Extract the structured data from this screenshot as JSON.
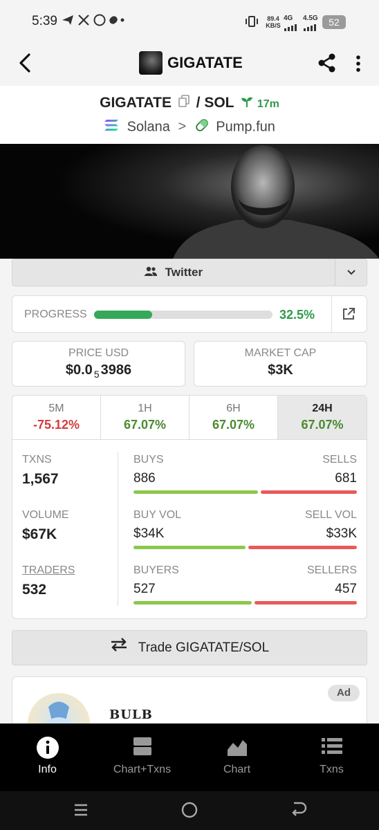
{
  "status_bar": {
    "time": "5:39",
    "net_speed": "89.4 KB/S",
    "signal1": "4G",
    "signal2": "4.5G",
    "battery": "52"
  },
  "app_bar": {
    "title": "GIGATATE"
  },
  "header": {
    "pair_base": "GIGATATE",
    "pair_sep": "/",
    "pair_quote": "SOL",
    "age": "17m",
    "chain": "Solana",
    "chevron": ">",
    "dex": "Pump.fun"
  },
  "twitter_button": {
    "label": "Twitter"
  },
  "progress": {
    "label": "PROGRESS",
    "value": "32.5%",
    "fraction": 0.325
  },
  "price": {
    "label": "PRICE USD",
    "prefix": "$0.0",
    "subscript": "5",
    "suffix": "3986"
  },
  "market_cap": {
    "label": "MARKET CAP",
    "value": "$3K"
  },
  "timeframes": [
    {
      "label": "5M",
      "change": "-75.12%"
    },
    {
      "label": "1H",
      "change": "67.07%"
    },
    {
      "label": "6H",
      "change": "67.07%"
    },
    {
      "label": "24H",
      "change": "67.07%"
    }
  ],
  "stats": {
    "txns": {
      "label": "TXNS",
      "value": "1,567"
    },
    "volume": {
      "label": "VOLUME",
      "value": "$67K"
    },
    "traders": {
      "label": "TRADERS",
      "value": "532"
    },
    "buys": {
      "label": "BUYS",
      "value": "886"
    },
    "sells": {
      "label": "SELLS",
      "value": "681"
    },
    "buy_vol": {
      "label": "BUY VOL",
      "value": "$34K"
    },
    "sell_vol": {
      "label": "SELL VOL",
      "value": "$33K"
    },
    "buyers": {
      "label": "BUYERS",
      "value": "527"
    },
    "sellers": {
      "label": "SELLERS",
      "value": "457"
    }
  },
  "trade_button": {
    "label": "Trade GIGATATE/SOL"
  },
  "ad": {
    "badge": "Ad",
    "name": "BULB"
  },
  "bottom_nav": [
    {
      "label": "Info"
    },
    {
      "label": "Chart+Txns"
    },
    {
      "label": "Chart"
    },
    {
      "label": "Txns"
    }
  ],
  "colors": {
    "green": "#35a85a",
    "red": "#d63a3a",
    "buy_bar": "#8cc84b",
    "sell_bar": "#e85a5a"
  }
}
